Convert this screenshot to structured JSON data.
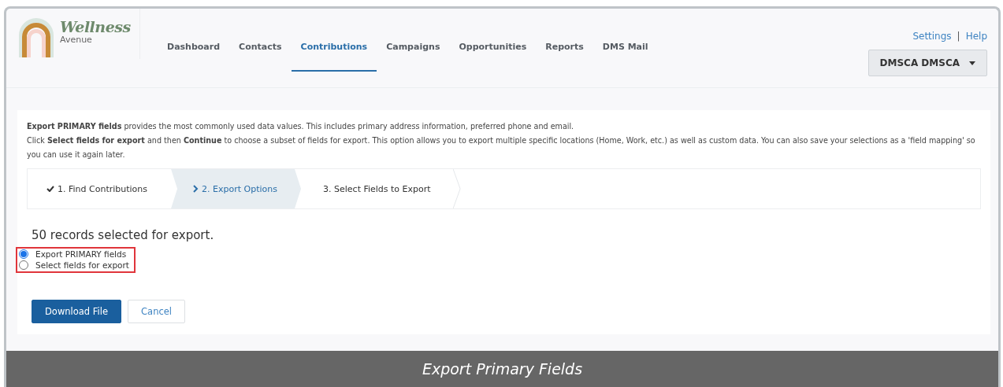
{
  "header": {
    "logo": {
      "name": "Wellness",
      "tagline": "Avenue"
    },
    "nav": [
      {
        "label": "Dashboard",
        "selected": false
      },
      {
        "label": "Contacts",
        "selected": false
      },
      {
        "label": "Contributions",
        "selected": true
      },
      {
        "label": "Campaigns",
        "selected": false
      },
      {
        "label": "Opportunities",
        "selected": false
      },
      {
        "label": "Reports",
        "selected": false
      },
      {
        "label": "DMS Mail",
        "selected": false
      }
    ],
    "links": [
      "Settings",
      "Help"
    ],
    "separator": "|",
    "user_menu": "DMSCA DMSCA"
  },
  "intro": [
    "**Export PRIMARY fields** provides the most commonly used data values. This includes primary address information, preferred phone and email.",
    "Click **Select fields for export** and then **Continue** to choose a subset of fields for export. This option allows you to export multiple specific locations (Home, Work, etc.) as well as custom data. You can also save your selections as a 'field mapping' so you can use it again later."
  ],
  "steps": [
    {
      "label": "1. Find Contributions",
      "kind": "done"
    },
    {
      "label": "2. Export Options",
      "kind": "current"
    },
    {
      "label": "3. Select Fields to Export",
      "kind": "pending"
    }
  ],
  "records_heading": "50 records selected for export.",
  "options": [
    {
      "label": "Export PRIMARY fields",
      "selected": true
    },
    {
      "label": "Select fields for export",
      "selected": false
    }
  ],
  "buttons": [
    {
      "label": "Download File",
      "kind": "primary"
    },
    {
      "label": "Cancel",
      "kind": "secondary"
    }
  ],
  "caption": "Export Primary Fields"
}
